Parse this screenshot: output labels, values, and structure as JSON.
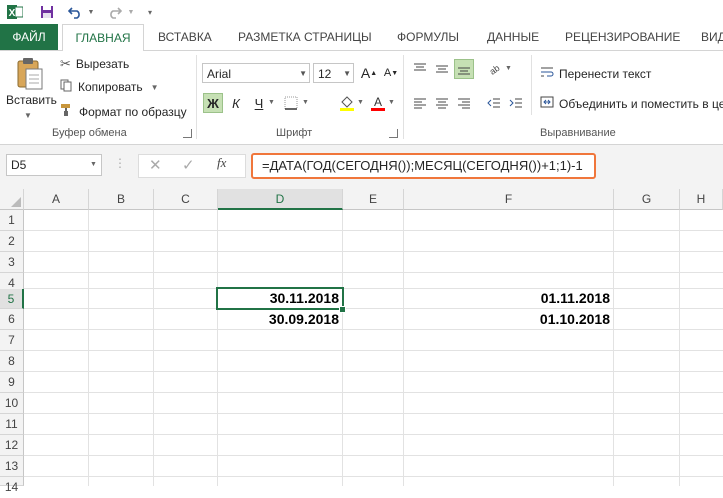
{
  "qat": {
    "icons": [
      "excel-logo-icon",
      "save-icon",
      "undo-icon",
      "redo-icon",
      "customize-icon"
    ]
  },
  "tabs": [
    "ФАЙЛ",
    "ГЛАВНАЯ",
    "ВСТАВКА",
    "РАЗМЕТКА СТРАНИЦЫ",
    "ФОРМУЛЫ",
    "ДАННЫЕ",
    "РЕЦЕНЗИРОВАНИЕ",
    "ВИД"
  ],
  "clipboard": {
    "paste_label": "Вставить",
    "cut_label": "Вырезать",
    "copy_label": "Копировать",
    "format_painter_label": "Формат по образцу",
    "group_label": "Буфер обмена"
  },
  "font": {
    "name": "Arial",
    "size": "12",
    "grow_label": "A",
    "shrink_label": "A",
    "bold_label": "Ж",
    "italic_label": "К",
    "underline_label": "Ч",
    "group_label": "Шрифт"
  },
  "alignment": {
    "wrap_label": "Перенести текст",
    "merge_label": "Объединить и поместить в це",
    "group_label": "Выравнивание"
  },
  "formula_bar": {
    "name_box": "D5",
    "formula": "=ДАТА(ГОД(СЕГОДНЯ());МЕСЯЦ(СЕГОДНЯ())+1;1)-1",
    "fx_label": "fx"
  },
  "sheet": {
    "columns": [
      "A",
      "B",
      "C",
      "D",
      "E",
      "F",
      "G",
      "H"
    ],
    "rows": [
      "1",
      "2",
      "3",
      "4",
      "5",
      "6",
      "7",
      "8",
      "9",
      "10",
      "11",
      "12",
      "13",
      "14"
    ],
    "selected_column": "D",
    "selected_row": "5",
    "cells": {
      "D5": "30.11.2018",
      "D6": "30.09.2018",
      "F5": "01.11.2018",
      "F6": "01.10.2018"
    }
  },
  "colors": {
    "accent": "#217346",
    "highlight_box": "#f0763b"
  }
}
